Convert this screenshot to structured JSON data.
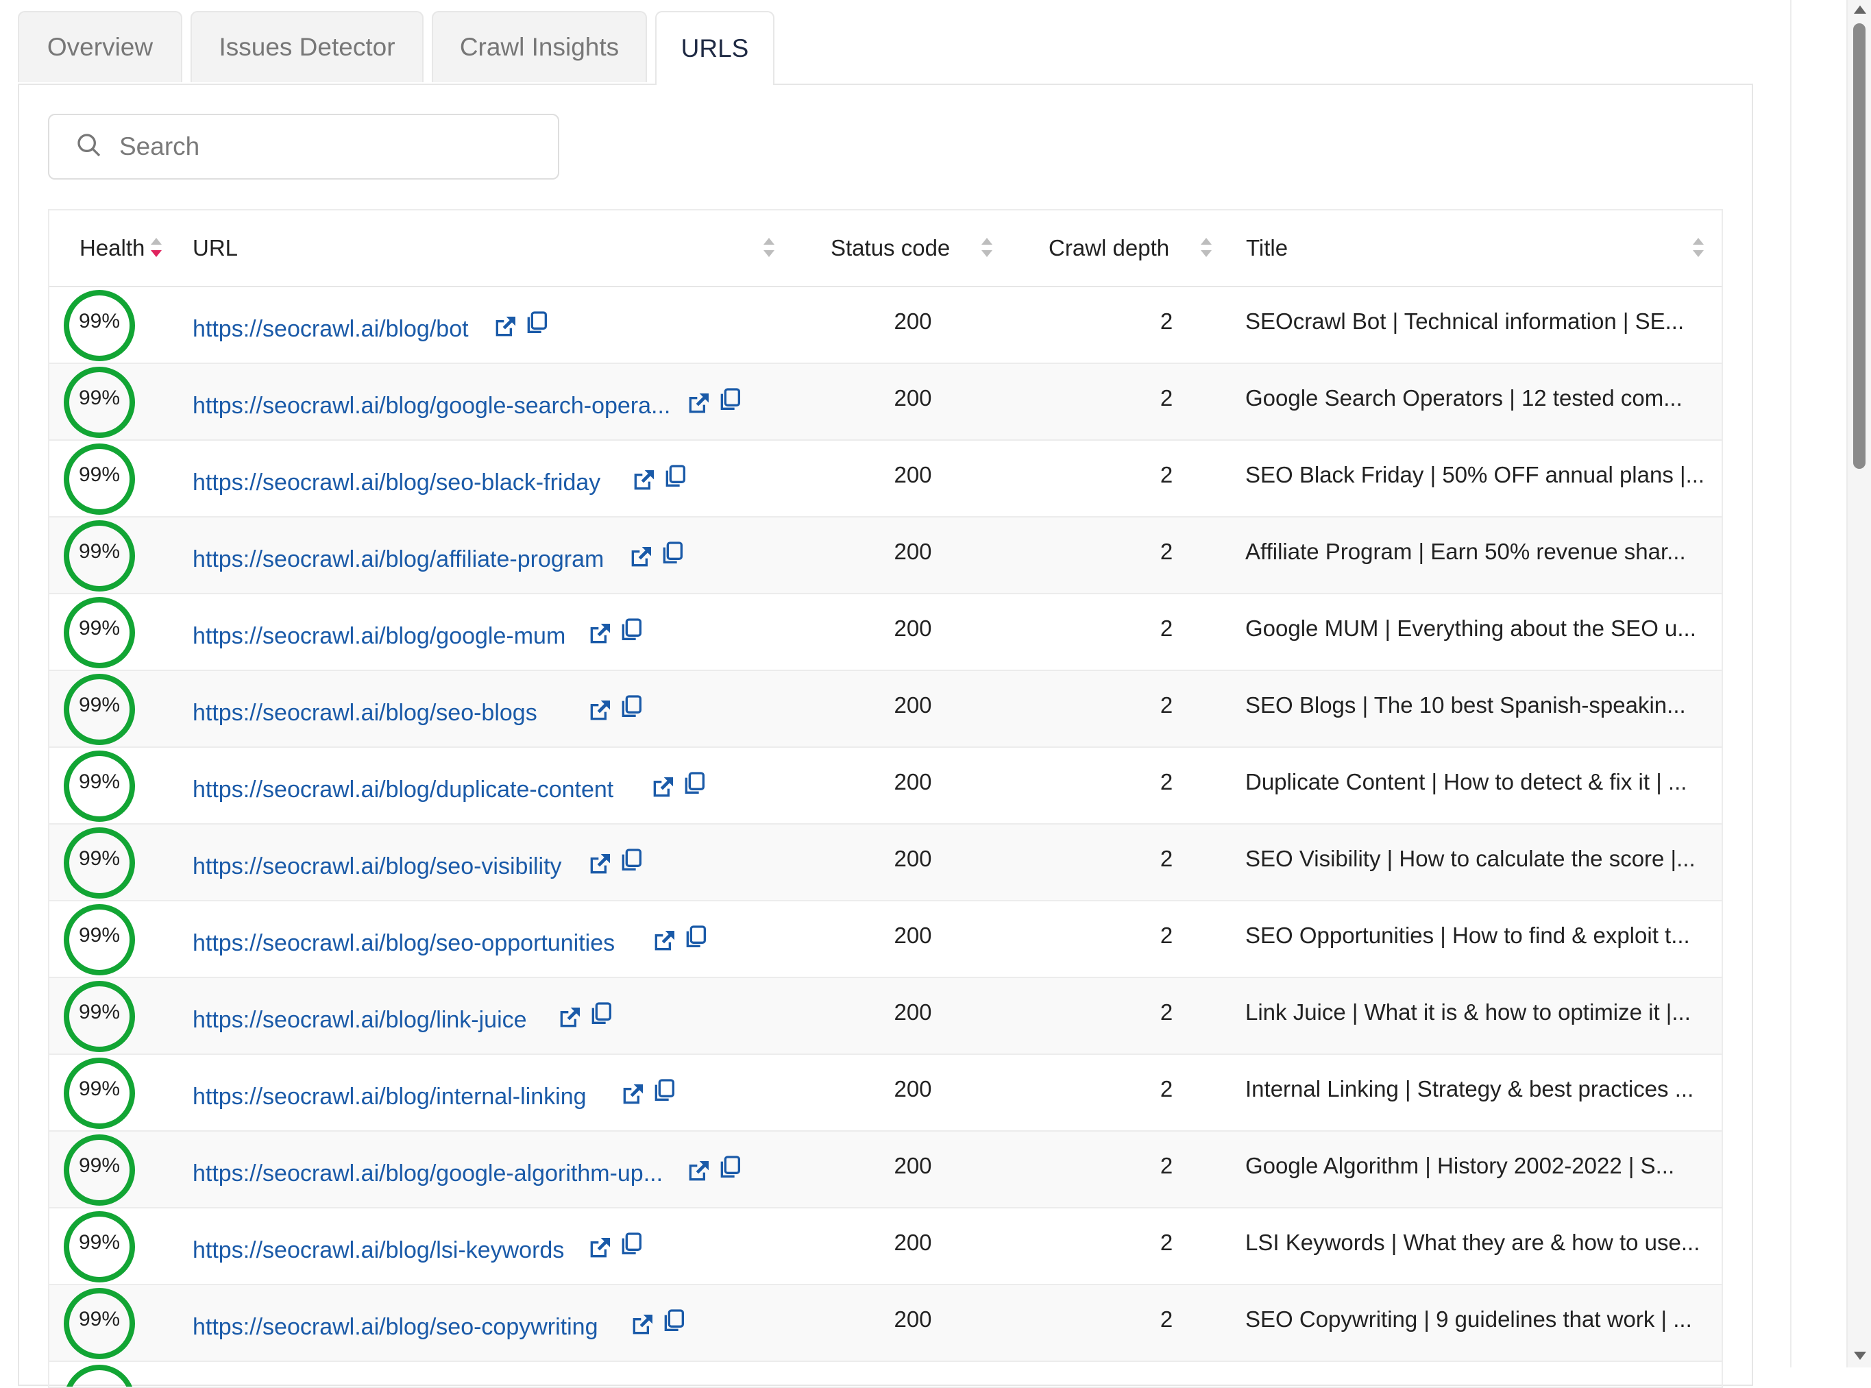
{
  "tabs": [
    {
      "label": "Overview",
      "active": false
    },
    {
      "label": "Issues Detector",
      "active": false
    },
    {
      "label": "Crawl Insights",
      "active": false
    },
    {
      "label": "URLS",
      "active": true
    }
  ],
  "search": {
    "placeholder": "Search",
    "value": ""
  },
  "table": {
    "headers": {
      "health": "Health",
      "url": "URL",
      "status_code": "Status code",
      "crawl_depth": "Crawl depth",
      "title": "Title"
    },
    "sorted_column": "health",
    "rows": [
      {
        "health": "99%",
        "url": "https://seocrawl.ai/blog/bot",
        "status": "200",
        "depth": "2",
        "title": "SEOcrawl Bot | Technical information | SE..."
      },
      {
        "health": "99%",
        "url": "https://seocrawl.ai/blog/google-search-opera...",
        "status": "200",
        "depth": "2",
        "title": "Google Search Operators | 12 tested com..."
      },
      {
        "health": "99%",
        "url": "https://seocrawl.ai/blog/seo-black-friday",
        "status": "200",
        "depth": "2",
        "title": "SEO Black Friday | 50% OFF annual plans |..."
      },
      {
        "health": "99%",
        "url": "https://seocrawl.ai/blog/affiliate-program",
        "status": "200",
        "depth": "2",
        "title": "Affiliate Program | Earn 50% revenue shar..."
      },
      {
        "health": "99%",
        "url": "https://seocrawl.ai/blog/google-mum",
        "status": "200",
        "depth": "2",
        "title": "Google MUM | Everything about the SEO u..."
      },
      {
        "health": "99%",
        "url": "https://seocrawl.ai/blog/seo-blogs",
        "status": "200",
        "depth": "2",
        "title": "SEO Blogs | The 10 best Spanish-speakin..."
      },
      {
        "health": "99%",
        "url": "https://seocrawl.ai/blog/duplicate-content",
        "status": "200",
        "depth": "2",
        "title": "Duplicate Content | How to detect & fix it | ..."
      },
      {
        "health": "99%",
        "url": "https://seocrawl.ai/blog/seo-visibility",
        "status": "200",
        "depth": "2",
        "title": "SEO Visibility | How to calculate the score |..."
      },
      {
        "health": "99%",
        "url": "https://seocrawl.ai/blog/seo-opportunities",
        "status": "200",
        "depth": "2",
        "title": "SEO Opportunities | How to find & exploit t..."
      },
      {
        "health": "99%",
        "url": "https://seocrawl.ai/blog/link-juice",
        "status": "200",
        "depth": "2",
        "title": "Link Juice | What it is & how to optimize it |..."
      },
      {
        "health": "99%",
        "url": "https://seocrawl.ai/blog/internal-linking",
        "status": "200",
        "depth": "2",
        "title": "Internal Linking | Strategy & best practices ..."
      },
      {
        "health": "99%",
        "url": "https://seocrawl.ai/blog/google-algorithm-up...",
        "status": "200",
        "depth": "2",
        "title": "Google Algorithm | History 2002-2022 | S..."
      },
      {
        "health": "99%",
        "url": "https://seocrawl.ai/blog/lsi-keywords",
        "status": "200",
        "depth": "2",
        "title": "LSI Keywords | What they are & how to use..."
      },
      {
        "health": "99%",
        "url": "https://seocrawl.ai/blog/seo-copywriting",
        "status": "200",
        "depth": "2",
        "title": "SEO Copywriting | 9 guidelines that work | ..."
      }
    ]
  },
  "colors": {
    "health_ring": "#12a534",
    "link": "#1a5aa8",
    "sort_active": "#e0245e"
  }
}
